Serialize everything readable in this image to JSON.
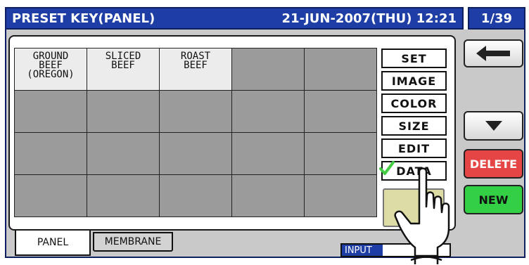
{
  "header": {
    "title": "PRESET KEY(PANEL)",
    "datetime": "21-JUN-2007(THU) 12:21",
    "page": "1/39"
  },
  "grid": {
    "rows": 4,
    "cols": 5,
    "cells": [
      "GROUND\nBEEF\n(OREGON)",
      "SLICED\nBEEF",
      "ROAST\nBEEF",
      "",
      "",
      "",
      "",
      "",
      "",
      "",
      "",
      "",
      "",
      "",
      "",
      "",
      "",
      "",
      "",
      ""
    ]
  },
  "function_buttons": [
    "SET",
    "IMAGE",
    "COLOR",
    "SIZE",
    "EDIT",
    "DATA"
  ],
  "selected_function": "DATA",
  "side": {
    "back_icon": "return-arrow-icon",
    "down_icon": "down-triangle-icon",
    "delete_label": "DELETE",
    "new_label": "NEW"
  },
  "tabs": [
    "PANEL",
    "MEMBRANE"
  ],
  "active_tab": "PANEL",
  "input": {
    "label": "INPUT",
    "level": 0.38
  },
  "colors": {
    "header_blue": "#1e3ea6",
    "delete_red": "#e64545",
    "new_green": "#33d045",
    "check_green": "#44cc44"
  }
}
